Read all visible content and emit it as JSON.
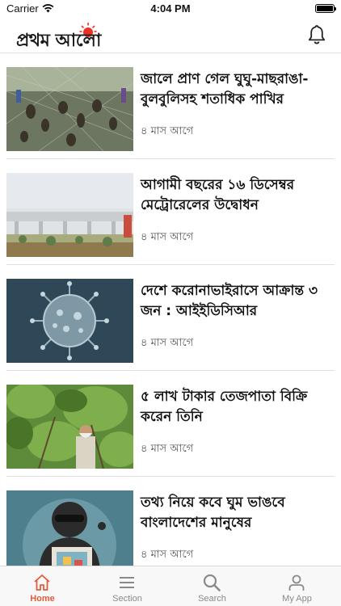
{
  "status_bar": {
    "carrier": "Carrier",
    "time": "4:04 PM"
  },
  "header": {
    "logo_text": "প্রথম আলো",
    "bell_icon": "bell-icon"
  },
  "articles": [
    {
      "headline": "জালে প্রাণ গেল ঘুঘু-মাছরাঙা-বুলবুলিসহ শতাধিক পাখির",
      "time": "৪ মাস আগে"
    },
    {
      "headline": "আগামী বছরের ১৬ ডিসেম্বর মেট্রোরেলের উদ্বোধন",
      "time": "৪ মাস আগে"
    },
    {
      "headline": "দেশে করোনাভাইরাসে আক্রান্ত ৩ জন : আইইডিসিআর",
      "time": "৪ মাস আগে"
    },
    {
      "headline": "৫ লাখ টাকার তেজপাতা বিক্রি করেন তিনি",
      "time": "৪ মাস আগে"
    },
    {
      "headline": "তথ্য নিয়ে কবে ঘুম ভাঙবে বাংলাদেশের মানুষের",
      "time": "৪ মাস আগে"
    }
  ],
  "tabs": [
    {
      "label": "Home",
      "icon": "home-icon",
      "active": true
    },
    {
      "label": "Section",
      "icon": "menu-icon",
      "active": false
    },
    {
      "label": "Search",
      "icon": "search-icon",
      "active": false
    },
    {
      "label": "My App",
      "icon": "user-icon",
      "active": false
    }
  ],
  "colors": {
    "accent": "#e35a3b",
    "logo_sun": "#ee3124",
    "text": "#111111",
    "muted": "#555555"
  }
}
